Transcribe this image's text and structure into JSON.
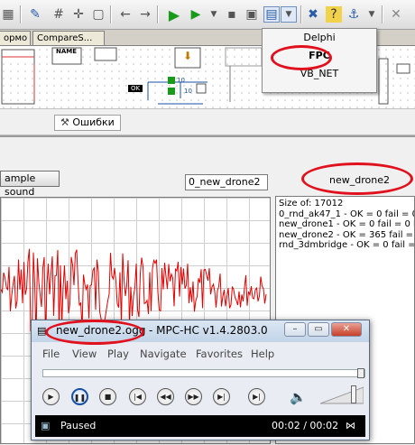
{
  "design_tabs": {
    "tab1": "ормо",
    "tab2": "CompareS..."
  },
  "design_labels": {
    "name": "NAME",
    "ok": "OK",
    "num_top": "10",
    "num_bottom": "10"
  },
  "panel_tab": "Ошибки",
  "popup_menu": {
    "items": [
      "Delphi",
      "FPC",
      "VB_NET"
    ]
  },
  "main": {
    "sample_button": "ample sound",
    "file_field": "0_new_drone2",
    "selected_label": "new_drone2",
    "memo_lines": [
      "Size of: 17012",
      "0_rnd_ak47_1 - OK = 0 fail = 0 b",
      "new_drone1 - OK = 0 fail = 0 br -",
      "new_drone2 - OK = 365 fail = 49",
      "rnd_3dmbridge - OK = 0 fail = 0 b"
    ]
  },
  "mpc": {
    "title_file": "new_drone2.ogg",
    "title_app": " - MPC-HC v1.4.2803.0",
    "menu": [
      "File",
      "View",
      "Play",
      "Navigate",
      "Favorites",
      "Help"
    ],
    "status": "Paused",
    "time": "00:02 / 00:02",
    "progress": 1.0,
    "volume": 0.8
  },
  "colors": {
    "annotation": "#e0101c",
    "wave": "#e00000",
    "accent_blue": "#1a4fa0"
  }
}
